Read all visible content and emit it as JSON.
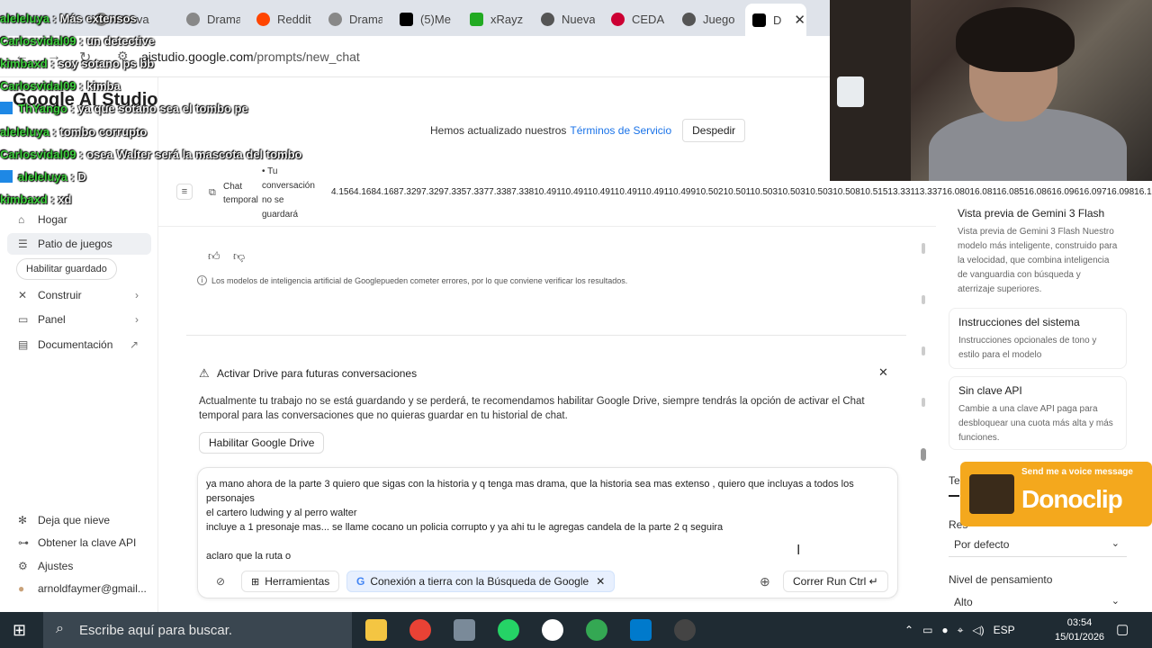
{
  "browser": {
    "tabs": [
      {
        "label": "Más extensos",
        "color": "#c0392b"
      },
      {
        "label": "Nueva",
        "color": "#888888"
      },
      {
        "label": "Drama",
        "color": "#888888"
      },
      {
        "label": "Reddit",
        "color": "#ff4500"
      },
      {
        "label": "Drama",
        "color": "#888888"
      },
      {
        "label": "(5)Me",
        "color": "#000000"
      },
      {
        "label": "xRayz",
        "color": "#22aa22"
      },
      {
        "label": "Nueva",
        "color": "#555555"
      },
      {
        "label": "CEDA",
        "color": "#cc0033"
      },
      {
        "label": "Juego",
        "color": "#555555"
      },
      {
        "label": "D",
        "color": "#000000"
      }
    ],
    "active_tab_close": "✕",
    "url_host": "aistudio.google.com",
    "url_path": "/prompts/new_chat"
  },
  "stream_chat": [
    {
      "user": "aleleluya",
      "msg": "Más extensos"
    },
    {
      "user": "Carlosvidal09",
      "msg": "un detective"
    },
    {
      "user": "kimbaxd",
      "msg": "soy sotano ps bb"
    },
    {
      "user": "Carlosvidal09",
      "msg": "kimba"
    },
    {
      "user": "ThYango",
      "msg": "ya que sotano sea el tombo pe"
    },
    {
      "user": "aleleluya",
      "msg": "tombo corrupto"
    },
    {
      "user": "Carlosvidal09",
      "msg": "osea Walter será la mascota del tombo"
    },
    {
      "user": "aleleluya",
      "msg": "D"
    },
    {
      "user": "kimbaxd",
      "msg": "xd"
    }
  ],
  "banner": {
    "text": "Hemos actualizado nuestros",
    "link": "Términos de Servicio",
    "dismiss": "Despedir"
  },
  "app": {
    "brand": "Google AI Studio",
    "header": {
      "chat_label_1": "Chat",
      "chat_label_2": "temporal",
      "note_1": "• Tu",
      "note_2": "conversación",
      "note_3": "no se",
      "note_4": "guardará"
    },
    "token_strip": "4.1564.1684.1687.3297.3297.3357.3377.3387.33810.49110.49110.49110.49110.49110.49910.50210.50110.50310.50310.50310.50810.51513.33113.33716.08016.08116.08516.08616.09616.09716.09816.10018.128"
  },
  "sidebar": {
    "items": [
      {
        "label": "Hogar",
        "icon": "home-icon",
        "glyph": "⌂"
      },
      {
        "label": "Patio de juegos",
        "icon": "playground-icon",
        "glyph": "☰"
      },
      {
        "label": "Construir",
        "icon": "build-icon",
        "glyph": "✕"
      },
      {
        "label": "Panel",
        "icon": "dashboard-icon",
        "glyph": "▭"
      },
      {
        "label": "Documentación",
        "icon": "docs-icon",
        "glyph": "▤"
      }
    ],
    "pill": "Habilitar guardado",
    "bottom": [
      {
        "label": "Deja que nieve",
        "icon": "snowflake-icon",
        "glyph": "✻"
      },
      {
        "label": "Obtener la clave API",
        "icon": "key-icon",
        "glyph": "⊶"
      },
      {
        "label": "Ajustes",
        "icon": "settings-icon",
        "glyph": "⚙"
      },
      {
        "label": "arnoldfaymer@gmail...",
        "icon": "avatar-icon",
        "glyph": "●"
      }
    ]
  },
  "chat": {
    "disclaimer": "Los modelos de inteligencia artificial de Googlepueden cometer errores, por lo que conviene verificar los resultados.",
    "drive": {
      "title": "Activar Drive para futuras conversaciones",
      "body": "Actualmente tu trabajo no se está guardando y se perderá, te recomendamos habilitar Google Drive, siempre tendrás la opción de activar el Chat temporal para las conversaciones que no quieras guardar en tu historial de chat.",
      "button": "Habilitar Google Drive"
    },
    "composer": {
      "text": "ya mano ahora de la parte 3 quiero que sigas con la historia y q tenga mas drama, que la historia sea mas extenso , quiero que incluyas a todos los personajes\nel cartero ludwing y al perro walter\nincluye a 1 presonaje mas... se llame cocano un policia corrupto y ya ahi tu le agregas candela de la parte 2 q seguira\n\naclaro que la ruta o",
      "tools": "Herramientas",
      "grounding": "Conexión a tierra con la Búsqueda de Google",
      "run": "Correr Run Ctrl ↵"
    }
  },
  "right_panel": {
    "model_title": "Vista previa de Gemini 3 Flash",
    "model_desc": "Vista previa de Gemini 3 Flash Nuestro modelo más inteligente, construido para la velocidad, que combina inteligencia de vanguardia con búsqueda y aterrizaje superiores.",
    "system_title": "Instrucciones del sistema",
    "system_desc": "Instrucciones opcionales de tono y estilo para el modelo",
    "api_title": "Sin clave API",
    "api_desc": "Cambie a una clave API paga para desbloquear una cuota más alta y más funciones.",
    "partial_label_1": "Te",
    "partial_label_2": "Res",
    "resolution_value": "Por defecto",
    "thinking_label": "Nivel de pensamiento",
    "thinking_value": "Alto"
  },
  "donoclip": {
    "small": "Send me a voice message",
    "big": "Donoclip"
  },
  "taskbar": {
    "search_placeholder": "Escribe aquí para buscar.",
    "lang": "ESP",
    "time": "03:54",
    "date": "15/01/2026"
  }
}
